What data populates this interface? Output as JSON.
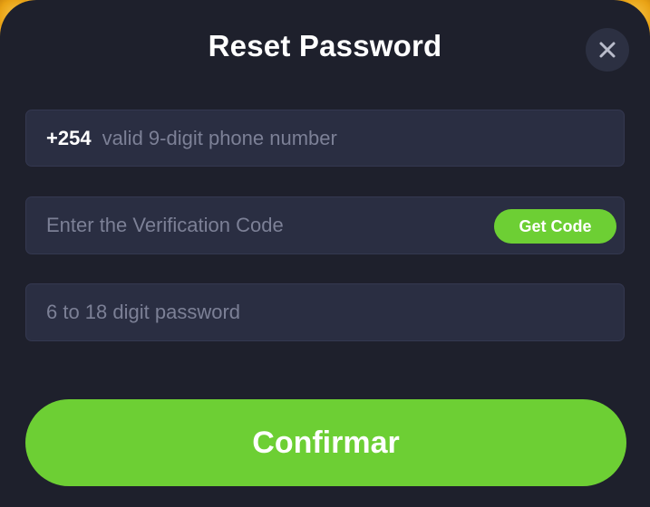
{
  "dialog": {
    "title": "Reset Password",
    "close_icon": "close-icon"
  },
  "form": {
    "phone": {
      "prefix": "+254",
      "placeholder": "valid 9-digit phone number",
      "value": ""
    },
    "verification": {
      "placeholder": "Enter the Verification Code",
      "value": "",
      "get_code_label": "Get Code"
    },
    "password": {
      "placeholder": "6 to 18 digit password",
      "value": ""
    },
    "submit_label": "Confirmar"
  },
  "colors": {
    "background": "#1e202c",
    "field": "#2a2e42",
    "accent": "#6dcf34",
    "placeholder": "#7c8096",
    "backdrop": "#f0a820"
  }
}
